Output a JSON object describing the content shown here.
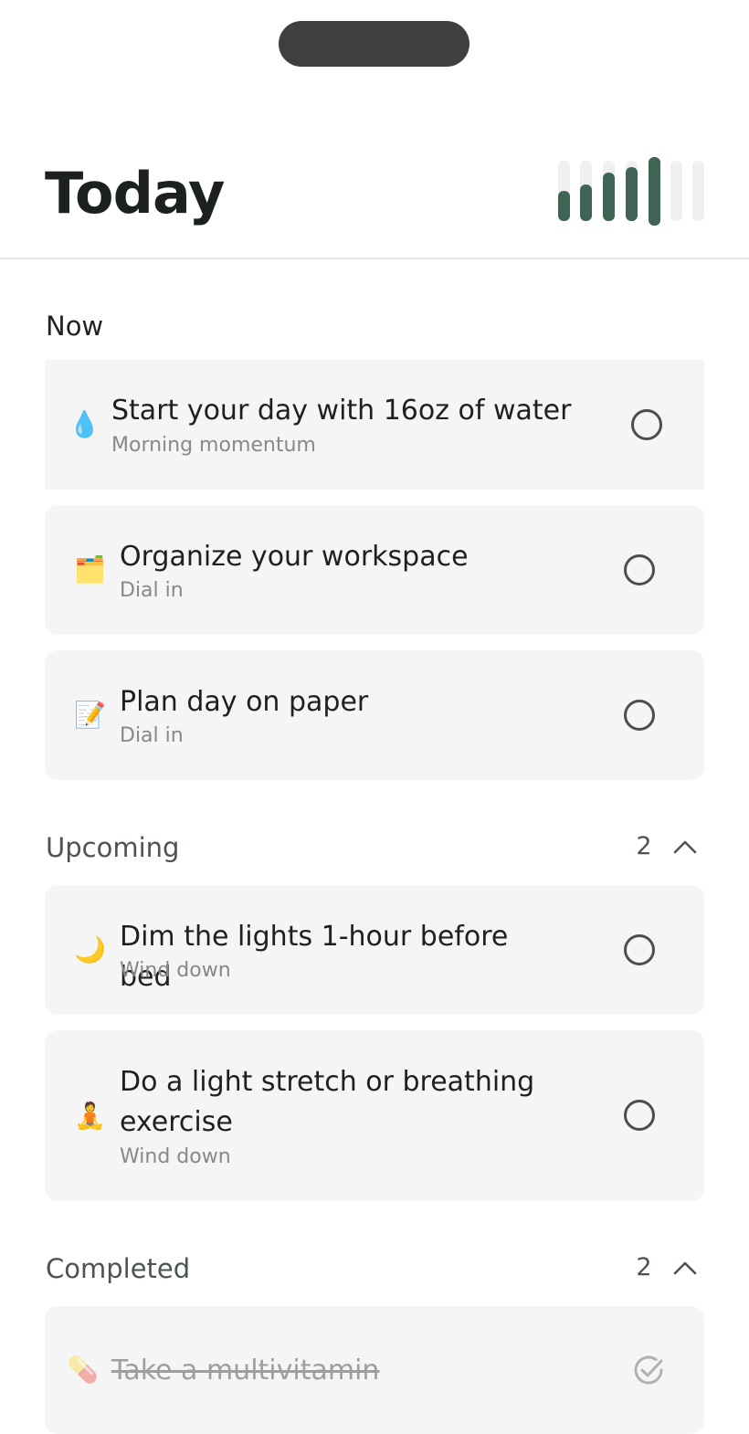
{
  "header": {
    "title": "Today",
    "progress_levels": [
      0.5,
      0.6,
      0.8,
      0.9,
      1.0,
      0,
      0
    ],
    "accent_color": "#3f6454"
  },
  "sections": {
    "now": {
      "label": "Now",
      "tasks": [
        {
          "emoji": "💧",
          "icon": "water-drop-icon",
          "title": "Start your day with 16oz of water",
          "subtitle": "Morning momentum"
        },
        {
          "emoji": "🗂️",
          "icon": "workspace-box-icon",
          "title": "Organize your workspace",
          "subtitle": "Dial in"
        },
        {
          "emoji": "📝",
          "icon": "memo-icon",
          "title": "Plan day on paper",
          "subtitle": "Dial in"
        }
      ]
    },
    "upcoming": {
      "label": "Upcoming",
      "count": "2",
      "tasks": [
        {
          "emoji": "🌙",
          "icon": "moon-icon",
          "title": "Dim the lights 1-hour before bed",
          "subtitle": "Wind down"
        },
        {
          "emoji": "🧘",
          "icon": "meditation-icon",
          "title": "Do a light stretch or breathing exercise",
          "subtitle": "Wind down"
        }
      ]
    },
    "completed": {
      "label": "Completed",
      "count": "2",
      "tasks": [
        {
          "emoji": "💊",
          "icon": "pill-icon",
          "title": "Take a multivitamin"
        }
      ]
    }
  }
}
